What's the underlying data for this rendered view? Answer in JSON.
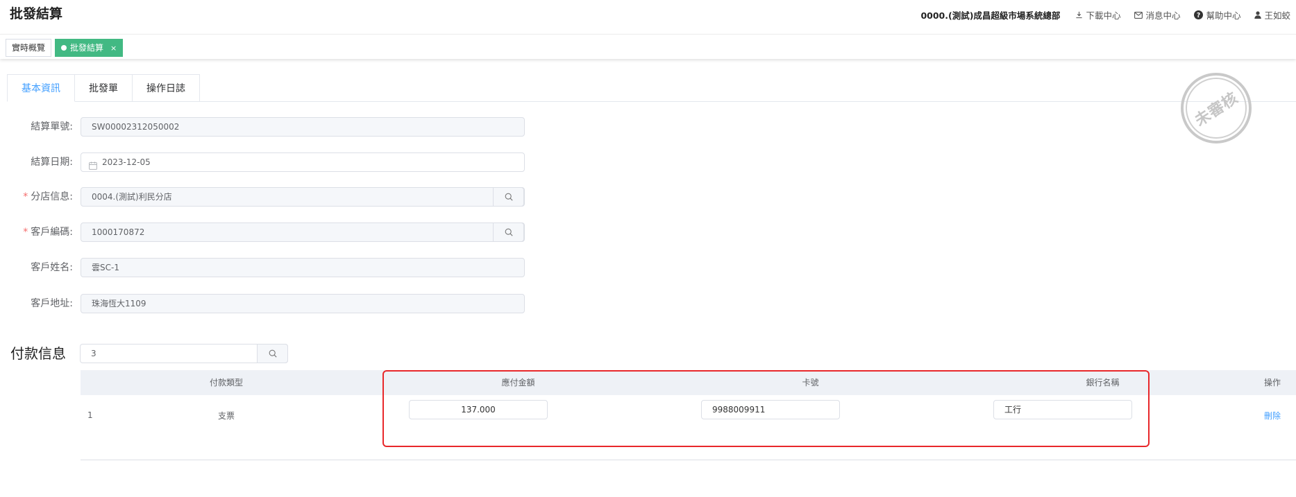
{
  "header": {
    "app_title": "批發結算",
    "org_name": "0000.(測試)成昌超級市場系統總部",
    "links": {
      "download": "下載中心",
      "messages": "消息中心",
      "help": "幫助中心",
      "user": "王如蛟"
    }
  },
  "tags": [
    {
      "label": "實時概覽",
      "active": false
    },
    {
      "label": "批發結算",
      "active": true,
      "close": "×"
    }
  ],
  "tabs": [
    {
      "label": "基本資訊",
      "active": true
    },
    {
      "label": "批發單",
      "active": false
    },
    {
      "label": "操作日誌",
      "active": false
    }
  ],
  "form": {
    "settlement_no": {
      "label": "結算單號:",
      "value": "SW00002312050002"
    },
    "settlement_date": {
      "label": "結算日期:",
      "value": "2023-12-05"
    },
    "branch": {
      "label": "分店信息:",
      "value": "0004.(測試)利民分店",
      "required": true
    },
    "customer_code": {
      "label": "客戶編碼:",
      "value": "1000170872",
      "required": true
    },
    "customer_name": {
      "label": "客戶姓名:",
      "value": "雲SC-1"
    },
    "customer_address": {
      "label": "客戶地址:",
      "value": "珠海恆大1109"
    }
  },
  "stamp": {
    "text": "未審核"
  },
  "payment": {
    "title": "付款信息",
    "search_value": "3",
    "columns": {
      "type": "付款類型",
      "amount": "應付金額",
      "card_no": "卡號",
      "bank_name": "銀行名稱",
      "action": "操作"
    },
    "rows": [
      {
        "index": "1",
        "type": "支票",
        "amount": "137.000",
        "card_no": "9988009911",
        "bank_name": "工行",
        "action": "刪除"
      }
    ]
  }
}
